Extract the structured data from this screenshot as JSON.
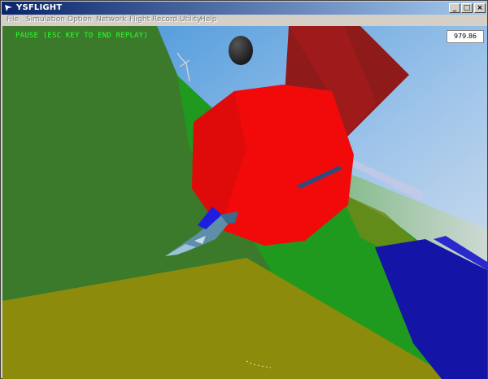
{
  "window": {
    "title": "YSFLIGHT",
    "controls": {
      "minimize": "_",
      "maximize": "□",
      "close": "×"
    }
  },
  "menubar": {
    "items": [
      "File",
      "Simulation",
      "Option",
      "Network",
      "Flight Record Utility",
      "Help"
    ]
  },
  "hud": {
    "status": "PAUSE (ESC KEY TO END REPLAY)",
    "readout": "979.86",
    "status_color": "#30ff30"
  },
  "scene": {
    "colors": {
      "sky": "#7fb4e6",
      "terrain_dark": "#3a7a2a",
      "terrain_bright": "#1f9a1f",
      "terrain_olive": "#8c8b0c",
      "balloon": "#f20a0a",
      "box_dark_red": "#8e1a1a",
      "water_blue": "#1414a6",
      "aircraft": "#5f8fa8",
      "sphere": "#1a1a1a"
    }
  }
}
